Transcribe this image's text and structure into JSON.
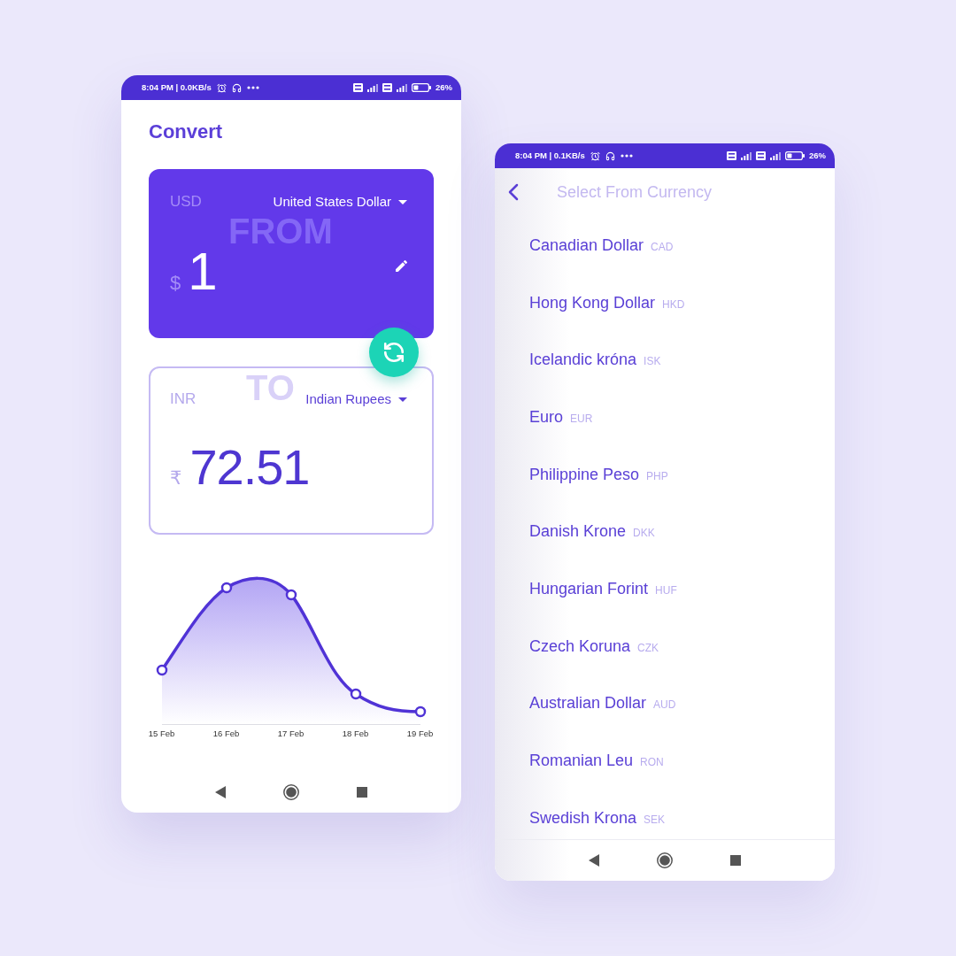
{
  "converter_screen": {
    "status_bar": {
      "status_text": "8:04 PM | 0.0KB/s",
      "battery_text": "26%"
    },
    "title": "Convert",
    "from_card": {
      "code": "USD",
      "watermark": "FROM",
      "currency": "United States Dollar",
      "symbol": "$",
      "amount": "1"
    },
    "to_card": {
      "code": "INR",
      "watermark": "TO",
      "currency": "Indian Rupees",
      "symbol": "₹",
      "amount": "72.51"
    },
    "chart": {
      "x_labels": [
        "15 Feb",
        "16 Feb",
        "17 Feb",
        "18 Feb",
        "19 Feb"
      ]
    }
  },
  "picker_screen": {
    "status_bar": {
      "status_text": "8:04 PM | 0.1KB/s",
      "battery_text": "26%"
    },
    "title": "Select From Currency",
    "currencies": [
      {
        "name": "Canadian Dollar",
        "code": "CAD"
      },
      {
        "name": "Hong Kong Dollar",
        "code": "HKD"
      },
      {
        "name": "Icelandic króna",
        "code": "ISK"
      },
      {
        "name": "Euro",
        "code": "EUR"
      },
      {
        "name": "Philippine Peso",
        "code": "PHP"
      },
      {
        "name": "Danish Krone",
        "code": "DKK"
      },
      {
        "name": "Hungarian Forint",
        "code": "HUF"
      },
      {
        "name": "Czech Koruna",
        "code": "CZK"
      },
      {
        "name": "Australian Dollar",
        "code": "AUD"
      },
      {
        "name": "Romanian Leu",
        "code": "RON"
      },
      {
        "name": "Swedish Krona",
        "code": "SEK"
      }
    ]
  }
}
